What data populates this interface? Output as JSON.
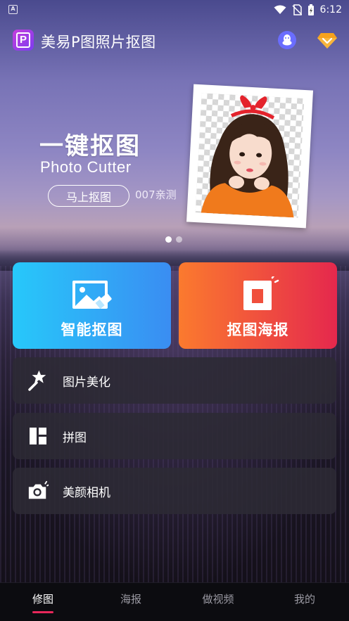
{
  "status_bar": {
    "time": "6:12",
    "notification_icon_letter": "A"
  },
  "app_bar": {
    "logo_letter": "P",
    "title": "美易P图照片抠图",
    "icons": [
      "qq-icon",
      "vip-diamond-icon"
    ]
  },
  "banner": {
    "title": "一键抠图",
    "subtitle": "Photo Cutter",
    "button_label": "马上抠图",
    "note": "007亲测",
    "page_count": 2,
    "active_page": 1
  },
  "features": {
    "smart_cutout": {
      "label": "智能抠图",
      "icon": "image-eraser-icon"
    },
    "cutout_poster": {
      "label": "抠图海报",
      "icon": "poster-frame-icon"
    }
  },
  "menu": [
    {
      "label": "图片美化",
      "icon": "magic-wand-icon"
    },
    {
      "label": "拼图",
      "icon": "collage-grid-icon"
    },
    {
      "label": "美颜相机",
      "icon": "camera-icon"
    }
  ],
  "bottom_nav": [
    {
      "label": "修图",
      "active": true
    },
    {
      "label": "海报",
      "active": false
    },
    {
      "label": "做视频",
      "active": false
    },
    {
      "label": "我的",
      "active": false
    }
  ],
  "colors": {
    "smart_card_gradient": [
      "#27c8fa",
      "#3a8df2"
    ],
    "poster_card_gradient": [
      "#fb7a2e",
      "#e5284d"
    ],
    "nav_active_indicator": "#e8275a"
  }
}
